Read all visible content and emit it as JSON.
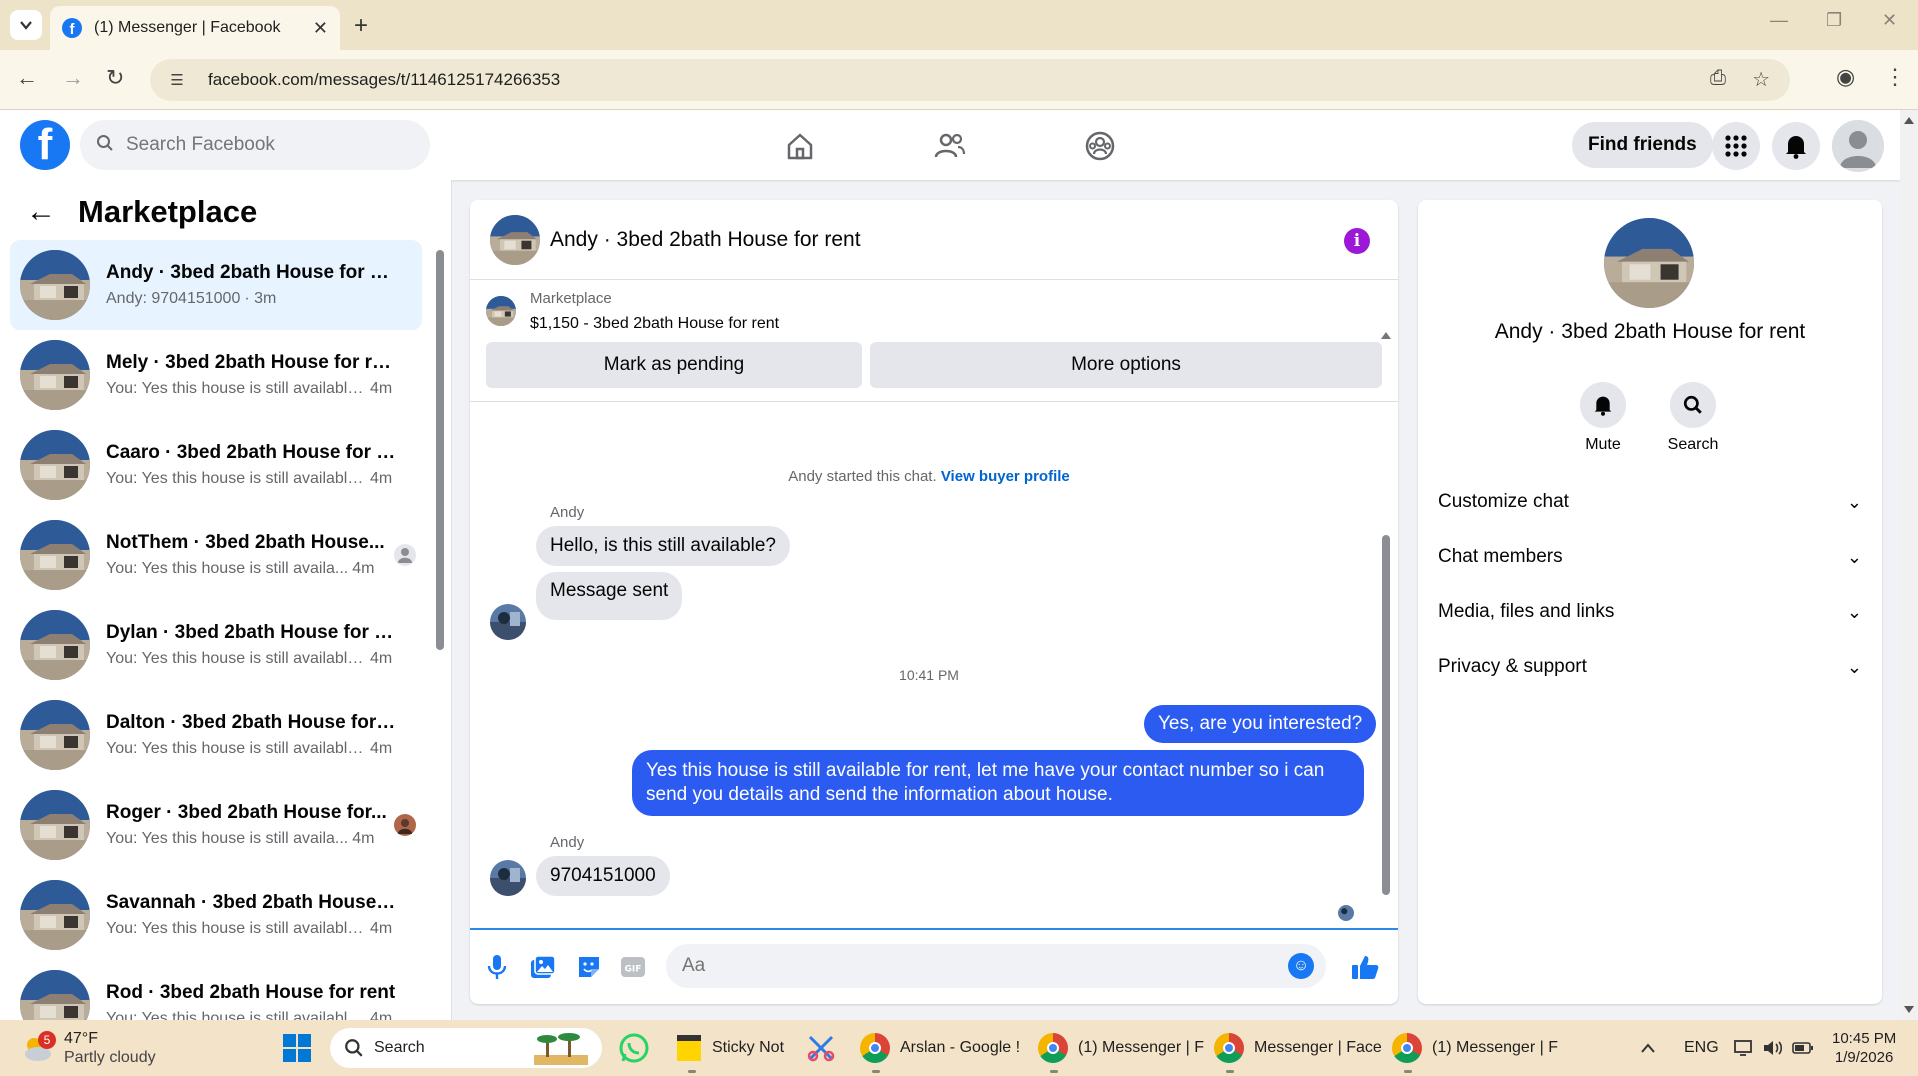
{
  "browser": {
    "tab_title": "(1) Messenger | Facebook",
    "new_tab": "+",
    "url": "facebook.com/messages/t/1146125174266353"
  },
  "fb_header": {
    "search_placeholder": "Search Facebook",
    "find_friends": "Find friends"
  },
  "left_panel": {
    "title": "Marketplace",
    "conversations": [
      {
        "name": "Andy · 3bed 2bath House for rent",
        "preview": "Andy: 9704151000",
        "time": "· 3m",
        "active": true
      },
      {
        "name": "Mely · 3bed 2bath House for rent",
        "preview": "You: Yes this house is still available ...",
        "time": "4m"
      },
      {
        "name": "Caaro · 3bed 2bath House for rent",
        "preview": "You: Yes this house is still available ...",
        "time": "4m"
      },
      {
        "name": "NotThem · 3bed 2bath House...",
        "preview": "You: Yes this house is still availa...",
        "time": "4m"
      },
      {
        "name": "Dylan · 3bed 2bath House for rent",
        "preview": "You: Yes this house is still available ...",
        "time": "4m"
      },
      {
        "name": "Dalton · 3bed 2bath House for r...",
        "preview": "You: Yes this house is still available ...",
        "time": "4m"
      },
      {
        "name": "Roger · 3bed 2bath House for...",
        "preview": "You: Yes this house is still availa...",
        "time": "4m"
      },
      {
        "name": "Savannah · 3bed 2bath House fo...",
        "preview": "You: Yes this house is still available ...",
        "time": "4m"
      },
      {
        "name": "Rod · 3bed 2bath House for rent",
        "preview": "You: Yes this house is still available ...",
        "time": "4m"
      }
    ]
  },
  "chat": {
    "header_name": "Andy · 3bed 2bath House for rent",
    "marketplace_label": "Marketplace",
    "listing": "$1,150 - 3bed 2bath House for rent",
    "mark_pending": "Mark as pending",
    "more_options": "More options",
    "system_message": "Andy started this chat.",
    "system_link": "View buyer profile",
    "sender_name": "Andy",
    "messages": {
      "in_1": "Hello, is this still available?",
      "in_2": "Message sent",
      "timestamp": "10:41 PM",
      "out_1": "Yes, are you interested?",
      "out_2": "Yes this house is still available for rent, let me have your contact number so i can send you details and send the information about house.",
      "in_3": "9704151000"
    },
    "composer_placeholder": "Aa"
  },
  "info_panel": {
    "name": "Andy · 3bed 2bath House for rent",
    "mute": "Mute",
    "search": "Search",
    "sections": [
      "Customize chat",
      "Chat members",
      "Media, files and links",
      "Privacy & support"
    ]
  },
  "taskbar": {
    "weather_badge": "5",
    "temperature": "47°F",
    "weather": "Partly cloudy",
    "search": "Search",
    "sticky": "Sticky Not",
    "chrome_1": "Arslan - Google !",
    "chrome_2": "(1) Messenger | F",
    "chrome_3": "Messenger | Face",
    "chrome_4": "(1) Messenger | F",
    "lang": "ENG",
    "time": "10:45 PM",
    "date": "1/9/2026"
  },
  "colors": {
    "fb_blue": "#1877f2",
    "outgoing_bubble": "#2b5bf0",
    "incoming_bubble": "#e4e6eb",
    "active_conversation": "#e7f3ff",
    "info_icon": "#9b18d6"
  }
}
